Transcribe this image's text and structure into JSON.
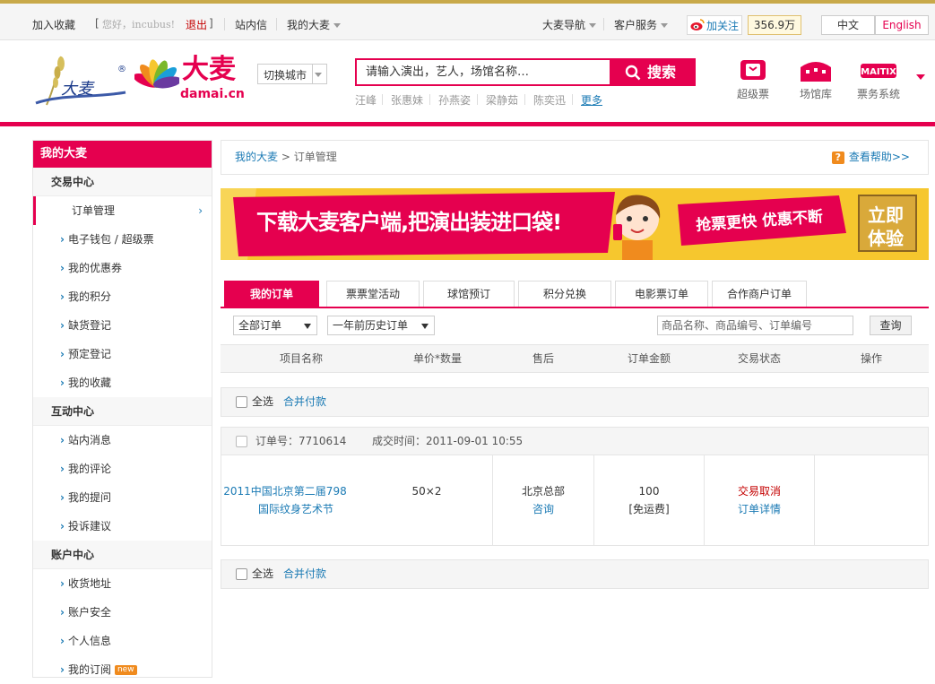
{
  "topbar": {
    "bookmark": "加入收藏",
    "bracket_left": "[",
    "greeting": "您好，incubus!",
    "logout": "退出",
    "bracket_right": "]",
    "site_msg": "站内信",
    "my_damai": "我的大麦",
    "nav": "大麦导航",
    "service": "客户服务",
    "follow": "加关注",
    "fans": "356.9万",
    "lang_cn": "中文",
    "lang_en": "English"
  },
  "header": {
    "logo_text": "大麦",
    "logo_domain": "damai.cn",
    "registered": "®",
    "city_switch": "切换城市",
    "search_placeholder": "请输入演出，艺人，场馆名称…",
    "search_button": "搜索",
    "hot": [
      "汪峰",
      "张惠妹",
      "孙燕姿",
      "梁静茹",
      "陈奕迅"
    ],
    "more": "更多",
    "quick_links": [
      "超级票",
      "场馆库",
      "票务系统"
    ],
    "maitix": "MAITIX"
  },
  "sidebar": {
    "title": "我的大麦",
    "sections": [
      {
        "title": "交易中心",
        "items": [
          "订单管理",
          "电子钱包 / 超级票",
          "我的优惠券",
          "我的积分",
          "缺货登记",
          "预定登记",
          "我的收藏"
        ]
      },
      {
        "title": "互动中心",
        "items": [
          "站内消息",
          "我的评论",
          "我的提问",
          "投诉建议"
        ]
      },
      {
        "title": "账户中心",
        "items": [
          "收货地址",
          "账户安全",
          "个人信息",
          "我的订阅"
        ]
      }
    ],
    "new_badge": "new"
  },
  "breadcrumb": {
    "home": "我的大麦",
    "separator": " > ",
    "current": "订单管理"
  },
  "help": {
    "icon": "?",
    "text": "查看帮助>>"
  },
  "banner": {
    "headline": "下载大麦客户端,把演出装进口袋!",
    "slogan": "抢票更快 优惠不断",
    "cta_line1": "立即",
    "cta_line2": "体验"
  },
  "tabs": [
    "我的订单",
    "票票堂活动",
    "球馆预订",
    "积分兑换",
    "电影票订单",
    "合作商户订单"
  ],
  "filter": {
    "status": "全部订单",
    "period": "一年前历史订单",
    "search_placeholder": "商品名称、商品编号、订单编号",
    "query": "查询"
  },
  "table_headers": [
    "项目名称",
    "单价*数量",
    "售后",
    "订单金额",
    "交易状态",
    "操作"
  ],
  "select_all": "全选",
  "merge_pay": "合并付款",
  "order": {
    "number_label": "订单号：",
    "number": "7710614",
    "time_label": "成交时间：",
    "time": "2011-09-01 10:55",
    "name_line1": "2011中国北京第二届798",
    "name_line2": "国际纹身艺术节",
    "price_qty": "50×2",
    "after_sale": "北京总部",
    "consult": "咨询",
    "amount": "100",
    "shipping": "[免运费]",
    "status": "交易取消",
    "detail": "订单详情"
  },
  "colors": {
    "brand": "#e5004f",
    "link": "#1a7ab4",
    "banner": "#f6c72e"
  }
}
